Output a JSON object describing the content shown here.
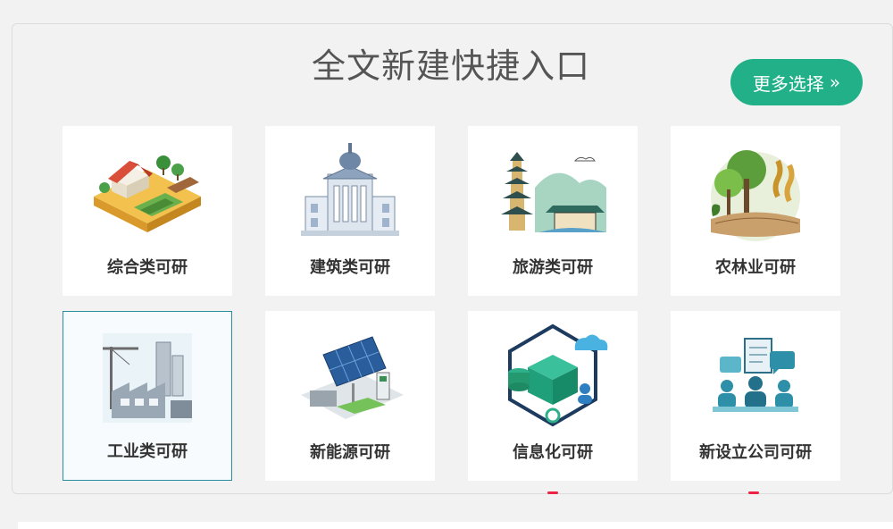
{
  "header": {
    "title": "全文新建快捷入口",
    "more_label": "更多选择",
    "more_arrow": "»"
  },
  "cards": [
    {
      "label": "综合类可研",
      "icon": "farm-house-icon"
    },
    {
      "label": "建筑类可研",
      "icon": "government-building-icon"
    },
    {
      "label": "旅游类可研",
      "icon": "pagoda-landscape-icon"
    },
    {
      "label": "农林业可研",
      "icon": "trees-wheat-icon"
    },
    {
      "label": "工业类可研",
      "icon": "factory-crane-icon"
    },
    {
      "label": "新能源可研",
      "icon": "solar-panel-charger-icon"
    },
    {
      "label": "信息化可研",
      "icon": "network-server-cloud-icon"
    },
    {
      "label": "新设立公司可研",
      "icon": "business-meeting-icon"
    }
  ],
  "colors": {
    "accent": "#21b088",
    "selected_border": "#2b8da0"
  }
}
